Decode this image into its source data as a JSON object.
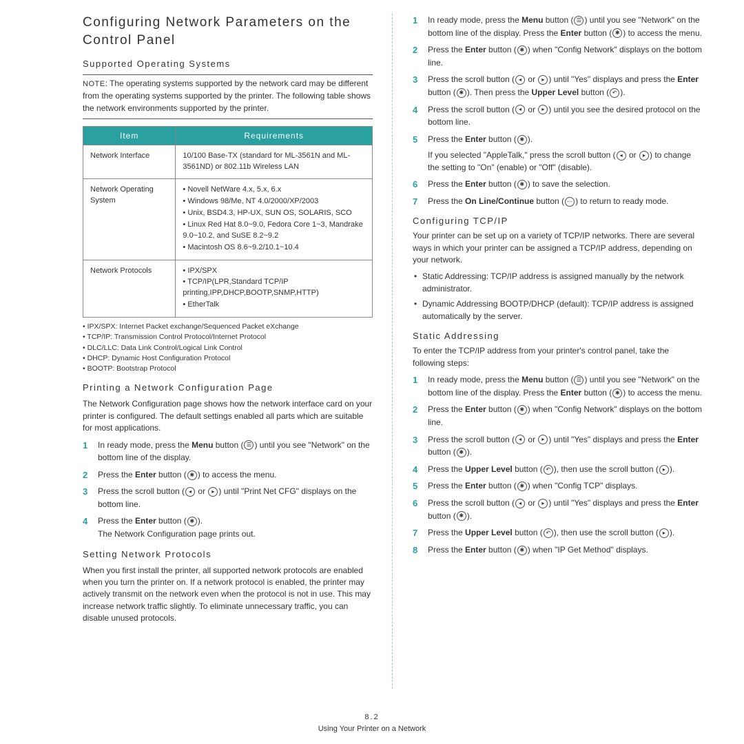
{
  "left": {
    "h1": "Configuring Network Parameters on the Control Panel",
    "h2_os": "Supported Operating Systems",
    "note_label": "NOTE",
    "note_text": ": The operating systems supported by the network card may be different from the operating systems supported by the printer. The following table shows the network environments supported by the printer.",
    "table": {
      "head_item": "Item",
      "head_req": "Requirements",
      "rows": [
        {
          "item": "Network Interface",
          "req_plain": "10/100 Base-TX (standard for ML-3561N and ML-3561ND) or 802.11b Wireless LAN"
        },
        {
          "item": "Network Operating System",
          "req_list": [
            "Novell NetWare 4.x, 5.x, 6.x",
            "Windows 98/Me, NT 4.0/2000/XP/2003",
            "Unix, BSD4.3, HP-UX, SUN OS, SOLARIS, SCO",
            "Linux Red Hat 8.0~9.0, Fedora Core 1~3, Mandrake 9.0~10.2, and SuSE 8.2~9.2",
            "Macintosh OS 8.6~9.2/10.1~10.4"
          ]
        },
        {
          "item": "Network Protocols",
          "req_list": [
            "IPX/SPX",
            "TCP/IP(LPR,Standard TCP/IP printing,IPP,DHCP,BOOTP,SNMP,HTTP)",
            "EtherTalk"
          ]
        }
      ]
    },
    "footnotes": [
      "IPX/SPX: Internet Packet exchange/Sequenced Packet eXchange",
      "TCP/IP: Transmission Control Protocol/Internet Protocol",
      "DLC/LLC: Data Link Control/Logical Link Control",
      "DHCP: Dynamic Host Configuration Protocol",
      "BOOTP: Bootstrap Protocol"
    ],
    "h2_print": "Printing a Network Configuration Page",
    "print_intro": "The Network Configuration page shows how the network interface card on your printer is configured. The default settings enabled all parts which are suitable for most applications.",
    "print_steps": {
      "s1a": "In ready mode, press the ",
      "s1b": "Menu",
      "s1c": " button (",
      "s1d": ") until you see \"Network\" on the bottom line of the display.",
      "s2a": "Press the ",
      "s2b": "Enter",
      "s2c": " button (",
      "s2d": ") to access the menu.",
      "s3a": "Press the scroll button (",
      "s3b": " or ",
      "s3c": ") until \"Print Net CFG\" displays on the bottom line.",
      "s4a": "Press the ",
      "s4b": "Enter",
      "s4c": " button (",
      "s4d": ").",
      "s4e": "The Network Configuration page prints out."
    },
    "h2_proto": "Setting Network Protocols",
    "proto_text": "When you first install the printer, all supported network protocols are enabled when you turn the printer on. If a network protocol is enabled, the printer may actively transmit on the network even when the protocol is not in use. This may increase network traffic slightly. To eliminate unnecessary traffic, you can disable unused protocols."
  },
  "right": {
    "proto_steps": {
      "s1a": "In ready mode, press the ",
      "s1b": "Menu",
      "s1c": " button (",
      "s1d": ") until you see \"Network\" on the bottom line of the display. Press the ",
      "s1e": "Enter",
      "s1f": " button (",
      "s1g": ") to access the menu.",
      "s2a": "Press the ",
      "s2b": "Enter",
      "s2c": " button (",
      "s2d": ") when \"Config Network\" displays on the bottom line.",
      "s3a": "Press the scroll button (",
      "s3b": " or ",
      "s3c": ") until \"Yes\" displays and press the ",
      "s3d": "Enter",
      "s3e": " button (",
      "s3f": "). Then press the ",
      "s3g": "Upper Level",
      "s3h": " button (",
      "s3i": ").",
      "s4a": "Press the scroll button (",
      "s4b": " or ",
      "s4c": ") until you see the desired protocol on the bottom line.",
      "s5a": "Press the ",
      "s5b": "Enter",
      "s5c": " button (",
      "s5d": ").",
      "s5e": "If you selected \"AppleTalk,\" press the scroll button (",
      "s5f": " or ",
      "s5g": ") to change the setting to \"On\" (enable) or \"Off\" (disable).",
      "s6a": "Press the ",
      "s6b": "Enter",
      "s6c": " button (",
      "s6d": ") to save the selection.",
      "s7a": "Press the ",
      "s7b": "On Line/Continue",
      "s7c": " button (",
      "s7d": ") to return to ready mode."
    },
    "h3_tcp": "Configuring TCP/IP",
    "tcp_intro": "Your printer can be set up on a variety of TCP/IP networks. There are several ways in which your printer can be assigned a TCP/IP address, depending on your network.",
    "tcp_bullets": [
      "Static Addressing: TCP/IP address is assigned manually by the network administrator.",
      "Dynamic Addressing BOOTP/DHCP (default): TCP/IP address is assigned automatically by the server."
    ],
    "h3_static": "Static Addressing",
    "static_intro": "To enter the TCP/IP address from your printer's control panel, take the following steps:",
    "static_steps": {
      "s1a": "In ready mode, press the ",
      "s1b": "Menu",
      "s1c": " button (",
      "s1d": ") until you see \"Network\" on the bottom line of the display. Press the ",
      "s1e": "Enter",
      "s1f": " button (",
      "s1g": ") to access the menu.",
      "s2a": "Press the ",
      "s2b": "Enter",
      "s2c": " button (",
      "s2d": ") when \"Config Network\" displays on the bottom line.",
      "s3a": "Press the scroll button (",
      "s3b": " or ",
      "s3c": ") until \"Yes\" displays and press the ",
      "s3d": "Enter",
      "s3e": " button (",
      "s3f": ").",
      "s4a": "Press the ",
      "s4b": "Upper Level",
      "s4c": " button (",
      "s4d": "), then use the scroll button (",
      "s4e": ").",
      "s5a": "Press the ",
      "s5b": "Enter",
      "s5c": " button (",
      "s5d": ") when \"Config TCP\" displays.",
      "s6a": "Press the scroll button (",
      "s6b": " or ",
      "s6c": ") until \"Yes\" displays and press the ",
      "s6d": "Enter",
      "s6e": " button (",
      "s6f": ").",
      "s7a": "Press the ",
      "s7b": "Upper Level",
      "s7c": " button (",
      "s7d": "), then use the scroll button  (",
      "s7e": ").",
      "s8a": "Press the ",
      "s8b": "Enter",
      "s8c": " button (",
      "s8d": ") when \"IP Get Method\" displays."
    }
  },
  "footer": {
    "page": "8.2",
    "title": "Using Your Printer on a Network"
  }
}
